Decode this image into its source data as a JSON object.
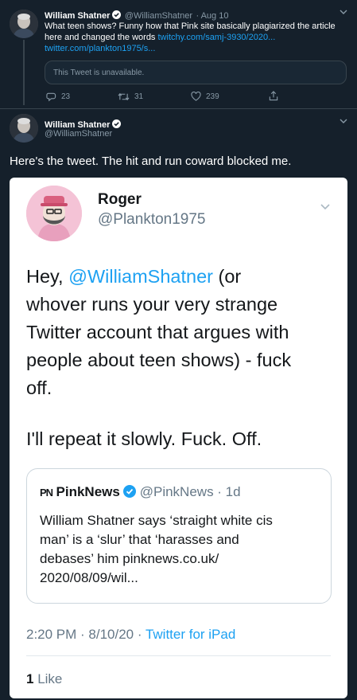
{
  "tweet1": {
    "name": "William Shatner",
    "handle": "@WilliamShatner",
    "date": "· Aug 10",
    "text_line1": "What teen shows? Funny how that Pink site basically plagiarized the article",
    "text_line2_plain": "here and changed the words",
    "text_line2_link": "twitchy.com/samj-3930/2020...",
    "text_line3_link": "twitter.com/plankton1975/s...",
    "unavailable_text": "This Tweet is unavailable.",
    "replies": "23",
    "retweets": "31",
    "likes": "239"
  },
  "tweet2": {
    "name": "William Shatner",
    "handle": "@WilliamShatner",
    "text": "Here's the tweet. The hit and run coward blocked me."
  },
  "screenshot": {
    "name": "Roger",
    "handle": "@Plankton1975",
    "body_line1_prefix": "Hey, ",
    "body_line1_mention": "@WilliamShatner",
    "body_line1_suffix": " (or",
    "body_line2": "whover runs your very strange",
    "body_line3": "Twitter account that argues with",
    "body_line4": "people about teen shows) - fuck",
    "body_line5": "off.",
    "body_line6": "I'll repeat it slowly. Fuck. Off.",
    "quote": {
      "logo": "PN",
      "name": "PinkNews",
      "handle": "@PinkNews · 1d",
      "line1": "William Shatner says ‘straight white cis",
      "line2": "man’ is a ‘slur’ that ‘harasses and",
      "line3": "debases’ him pinknews.co.uk/",
      "line4": "2020/08/09/wil..."
    },
    "meta_time": "2:20 PM · 8/10/20 · ",
    "meta_source": "Twitter for iPad",
    "likes_count": "1",
    "likes_label": " Like"
  },
  "colors": {
    "background": "#15202b",
    "accent": "#1da1f2",
    "muted": "#8899a6",
    "border": "#38444d"
  },
  "icons": [
    "verified-badge-icon",
    "chevron-down-icon",
    "reply-icon",
    "retweet-icon",
    "like-icon",
    "share-icon"
  ]
}
